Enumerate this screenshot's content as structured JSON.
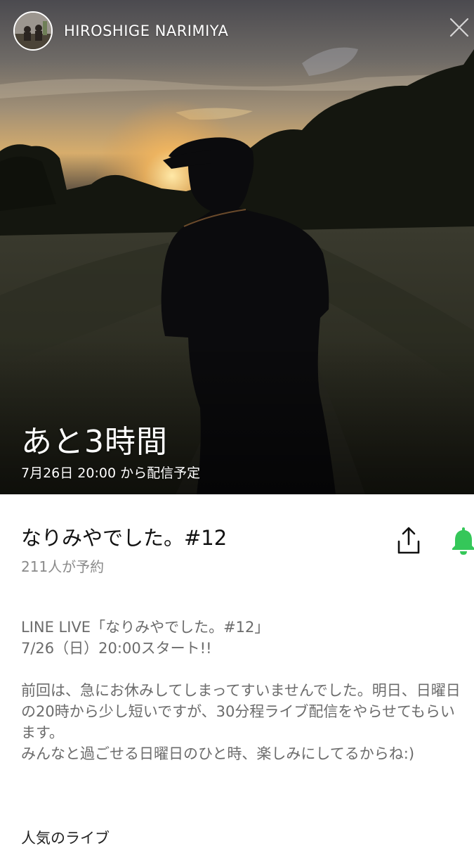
{
  "header": {
    "channel_name": "HIROSHIGE NARIMIYA",
    "avatar_icon": "avatar-photo-icon",
    "close_icon": "close-icon"
  },
  "hero": {
    "countdown": "あと3時間",
    "schedule": "7月26日 20:00 から配信予定"
  },
  "broadcast": {
    "title": "なりみやでした。#12",
    "reservations": "211人が予約",
    "share_icon": "share-icon",
    "bell_icon": "bell-icon",
    "bell_color": "#35c759"
  },
  "description": {
    "lines": [
      "LINE LIVE「なりみやでした。#12」",
      "7/26（日）20:00スタート!!",
      "",
      "前回は、急にお休みしてしまってすいませんでした。明日、日曜日の20時から少し短いですが、30分程ライブ配信をやらせてもらいます。",
      "みんなと過ごせる日曜日のひと時、楽しみにしてるからね:)"
    ]
  },
  "sections": {
    "popular_label": "人気のライブ"
  }
}
